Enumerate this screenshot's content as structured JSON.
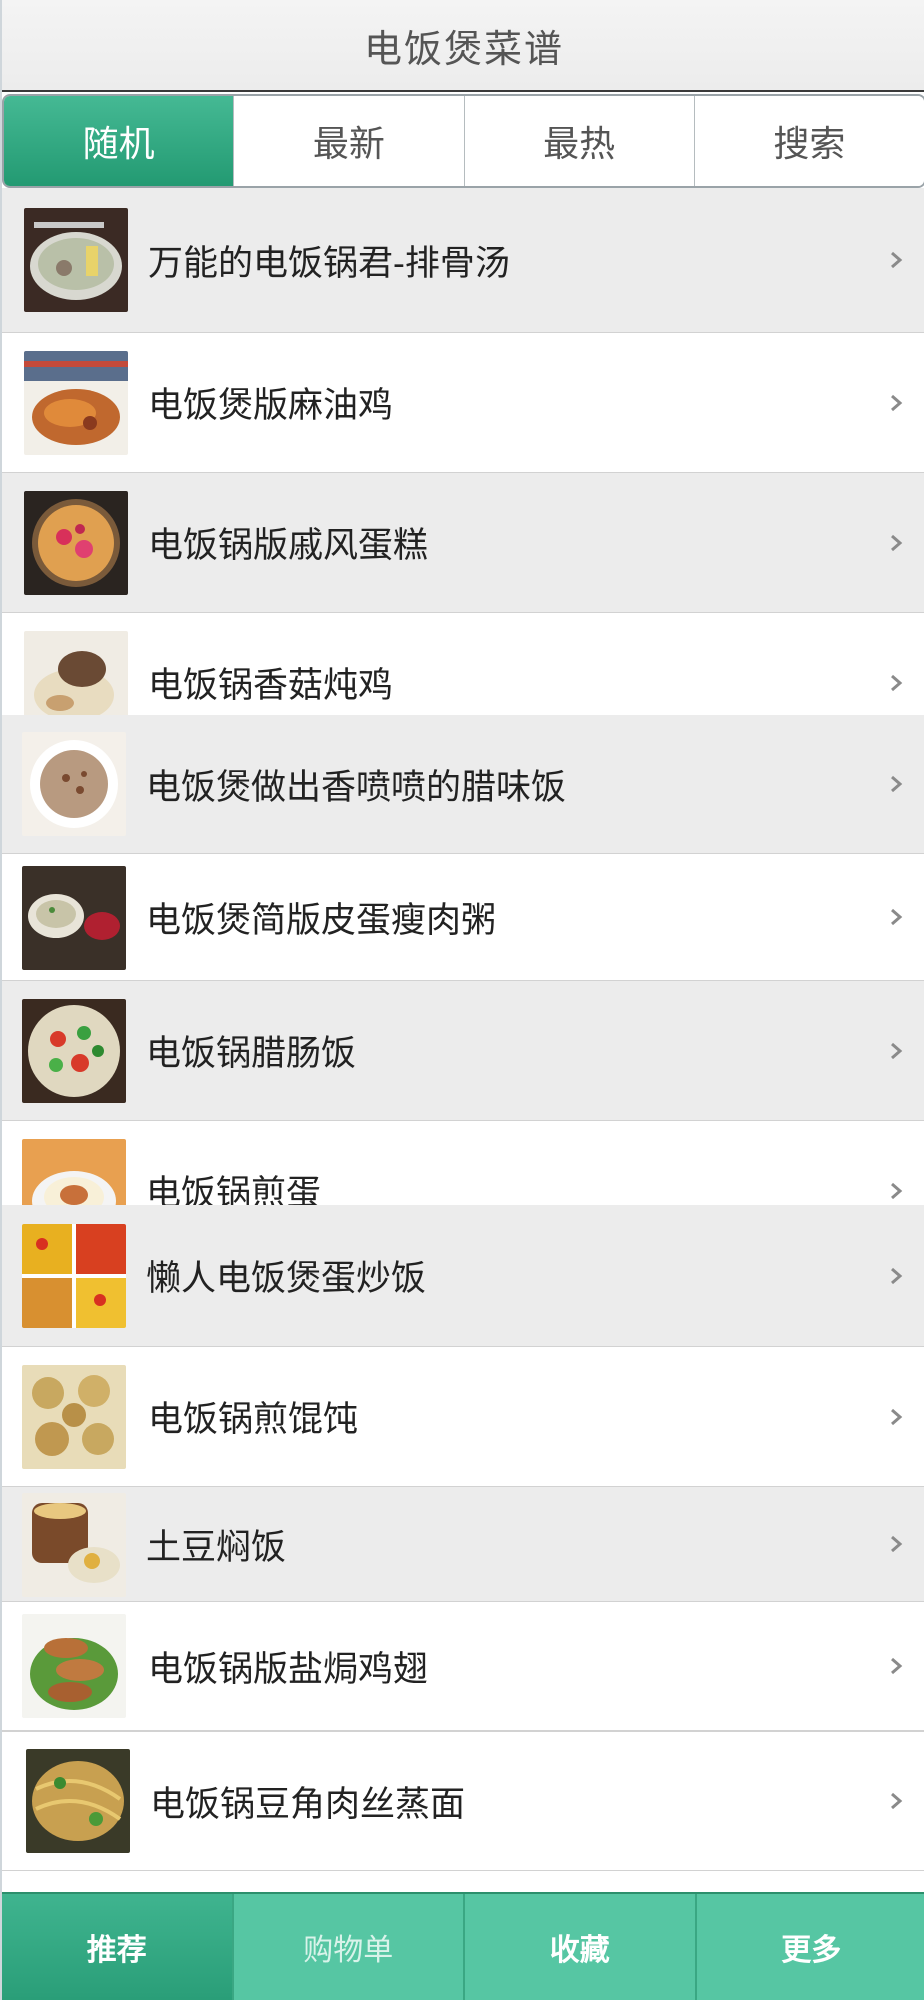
{
  "header": {
    "title": "电饭煲菜谱"
  },
  "tabs": [
    {
      "label": "随机",
      "active": true
    },
    {
      "label": "最新",
      "active": false
    },
    {
      "label": "最热",
      "active": false
    },
    {
      "label": "搜索",
      "active": false
    }
  ],
  "recipes": [
    {
      "title": "万能的电饭锅君-排骨汤",
      "thumb_icon": "soup-bowl-photo"
    },
    {
      "title": "电饭煲版麻油鸡",
      "thumb_icon": "sesame-chicken-photo"
    },
    {
      "title": "电饭锅版戚风蛋糕",
      "thumb_icon": "chiffon-cake-photo"
    },
    {
      "title": "电饭锅香菇炖鸡",
      "thumb_icon": "mushroom-chicken-photo"
    },
    {
      "title": "电饭煲做出香喷喷的腊味饭",
      "thumb_icon": "cured-meat-rice-photo"
    },
    {
      "title": "电饭煲简版皮蛋瘦肉粥",
      "thumb_icon": "congee-photo"
    },
    {
      "title": "电饭锅腊肠饭",
      "thumb_icon": "sausage-rice-photo"
    },
    {
      "title": "电饭锅煎蛋",
      "thumb_icon": "fried-egg-photo"
    },
    {
      "title": "懒人电饭煲蛋炒饭",
      "thumb_icon": "egg-fried-rice-photo"
    },
    {
      "title": "电饭锅煎馄饨",
      "thumb_icon": "wonton-photo"
    },
    {
      "title": "土豆焖饭",
      "thumb_icon": "potato-rice-photo"
    },
    {
      "title": "电饭锅版盐焗鸡翅",
      "thumb_icon": "chicken-wings-photo"
    },
    {
      "title": "电饭锅豆角肉丝蒸面",
      "thumb_icon": "noodles-photo"
    }
  ],
  "bottom_nav": [
    {
      "label": "推荐",
      "active": true
    },
    {
      "label": "购物单",
      "active": false
    },
    {
      "label": "收藏",
      "active": false
    },
    {
      "label": "更多",
      "active": false
    }
  ],
  "colors": {
    "accent": "#2aa57c",
    "nav_bg": "#56c6a3",
    "row_gray": "#ececec",
    "row_white": "#ffffff",
    "chevron": "#8a8a8a"
  }
}
